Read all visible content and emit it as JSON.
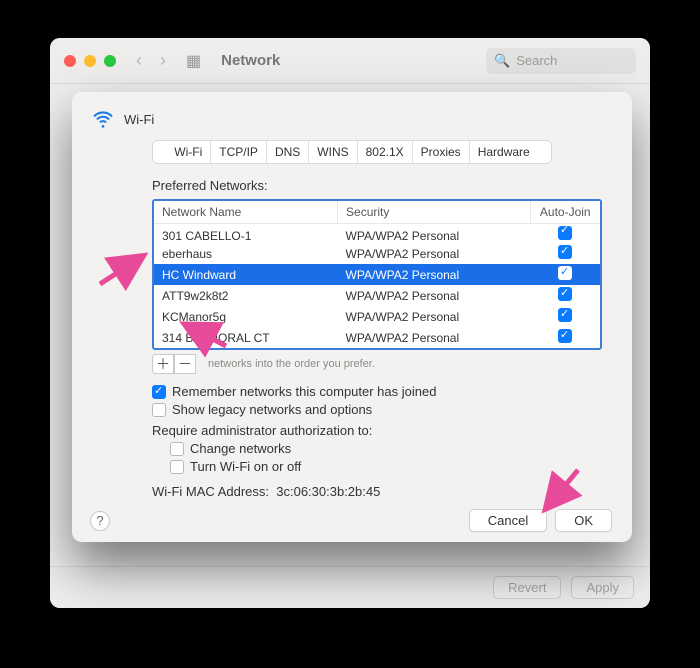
{
  "toolbar": {
    "title": "Network",
    "search_placeholder": "Search",
    "revert": "Revert",
    "apply": "Apply"
  },
  "sheet": {
    "title": "Wi-Fi",
    "tabs": [
      "Wi-Fi",
      "TCP/IP",
      "DNS",
      "WINS",
      "802.1X",
      "Proxies",
      "Hardware"
    ],
    "preferred_label": "Preferred Networks:",
    "columns": {
      "name": "Network Name",
      "security": "Security",
      "autojoin": "Auto-Join"
    },
    "rows": [
      {
        "name": "301 CABELLO-1",
        "security": "WPA/WPA2 Personal",
        "autojoin": true,
        "clipped": true
      },
      {
        "name": "eberhaus",
        "security": "WPA/WPA2 Personal",
        "autojoin": true
      },
      {
        "name": "HC Windward",
        "security": "WPA/WPA2 Personal",
        "autojoin": true,
        "selected": true
      },
      {
        "name": "ATT9w2k8t2",
        "security": "WPA/WPA2 Personal",
        "autojoin": true
      },
      {
        "name": "KCManor5g",
        "security": "WPA/WPA2 Personal",
        "autojoin": true
      },
      {
        "name": "314 BALMORAL CT",
        "security": "WPA/WPA2 Personal",
        "autojoin": true
      }
    ],
    "drag_hint": "networks into the order you prefer.",
    "remember_label": "Remember networks this computer has joined",
    "remember_checked": true,
    "legacy_label": "Show legacy networks and options",
    "legacy_checked": false,
    "require_label": "Require administrator authorization to:",
    "change_net_label": "Change networks",
    "turn_wifi_label": "Turn Wi-Fi on or off",
    "mac_label": "Wi-Fi MAC Address:",
    "mac_value": "3c:06:30:3b:2b:45",
    "cancel": "Cancel",
    "ok": "OK"
  }
}
